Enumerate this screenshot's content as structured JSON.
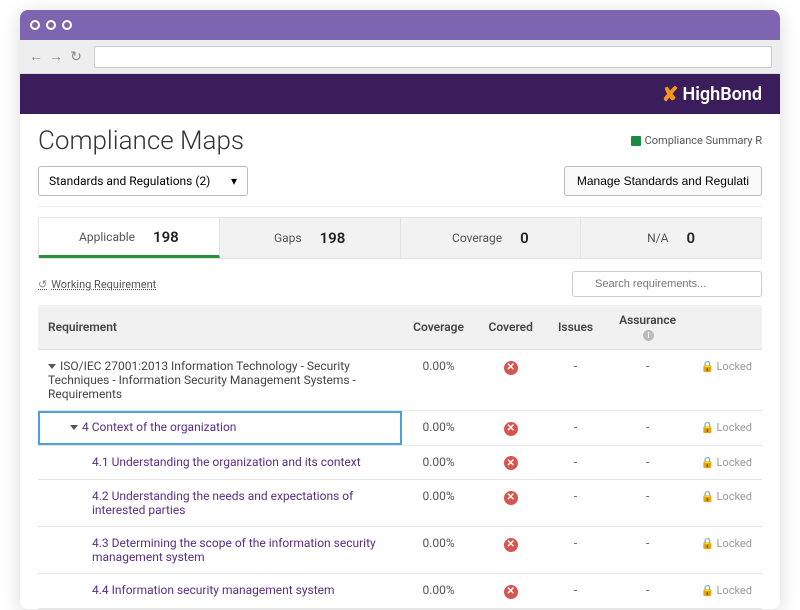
{
  "brand": "HighBond",
  "page_title": "Compliance Maps",
  "summary_link": "Compliance Summary R",
  "dropdown_label": "Standards and Regulations (2)",
  "manage_button": "Manage Standards and Regulati",
  "tabs": {
    "applicable": {
      "label": "Applicable",
      "count": "198"
    },
    "gaps": {
      "label": "Gaps",
      "count": "198"
    },
    "coverage": {
      "label": "Coverage",
      "count": "0"
    },
    "na": {
      "label": "N/A",
      "count": "0"
    }
  },
  "working_link": "Working Requirement",
  "search_placeholder": "Search requirements...",
  "columns": {
    "requirement": "Requirement",
    "coverage": "Coverage",
    "covered": "Covered",
    "issues": "Issues",
    "assurance": "Assurance",
    "locked": "Locked"
  },
  "rows": [
    {
      "name": "ISO/IEC 27001:2013 Information Technology - Security Techniques - Information Security Management Systems - Requirements",
      "coverage": "0.00%",
      "issues": "-",
      "assurance": "-",
      "indent": 0,
      "top": true,
      "caret": true,
      "covered_x": true,
      "locked": true,
      "selected": false
    },
    {
      "name": "4  Context of the organization",
      "coverage": "0.00%",
      "issues": "-",
      "assurance": "-",
      "indent": 1,
      "top": false,
      "caret": true,
      "covered_x": true,
      "locked": true,
      "selected": true
    },
    {
      "name": "4.1  Understanding the organization and its context",
      "coverage": "0.00%",
      "issues": "-",
      "assurance": "-",
      "indent": 2,
      "top": false,
      "caret": false,
      "covered_x": true,
      "locked": true,
      "selected": false
    },
    {
      "name": "4.2  Understanding the needs and expectations of interested parties",
      "coverage": "0.00%",
      "issues": "-",
      "assurance": "-",
      "indent": 2,
      "top": false,
      "caret": false,
      "covered_x": true,
      "locked": true,
      "selected": false
    },
    {
      "name": "4.3  Determining the scope of the information security management system",
      "coverage": "0.00%",
      "issues": "-",
      "assurance": "-",
      "indent": 2,
      "top": false,
      "caret": false,
      "covered_x": true,
      "locked": true,
      "selected": false
    },
    {
      "name": "4.4  Information security management system",
      "coverage": "0.00%",
      "issues": "-",
      "assurance": "-",
      "indent": 2,
      "top": false,
      "caret": false,
      "covered_x": true,
      "locked": true,
      "selected": false
    }
  ]
}
